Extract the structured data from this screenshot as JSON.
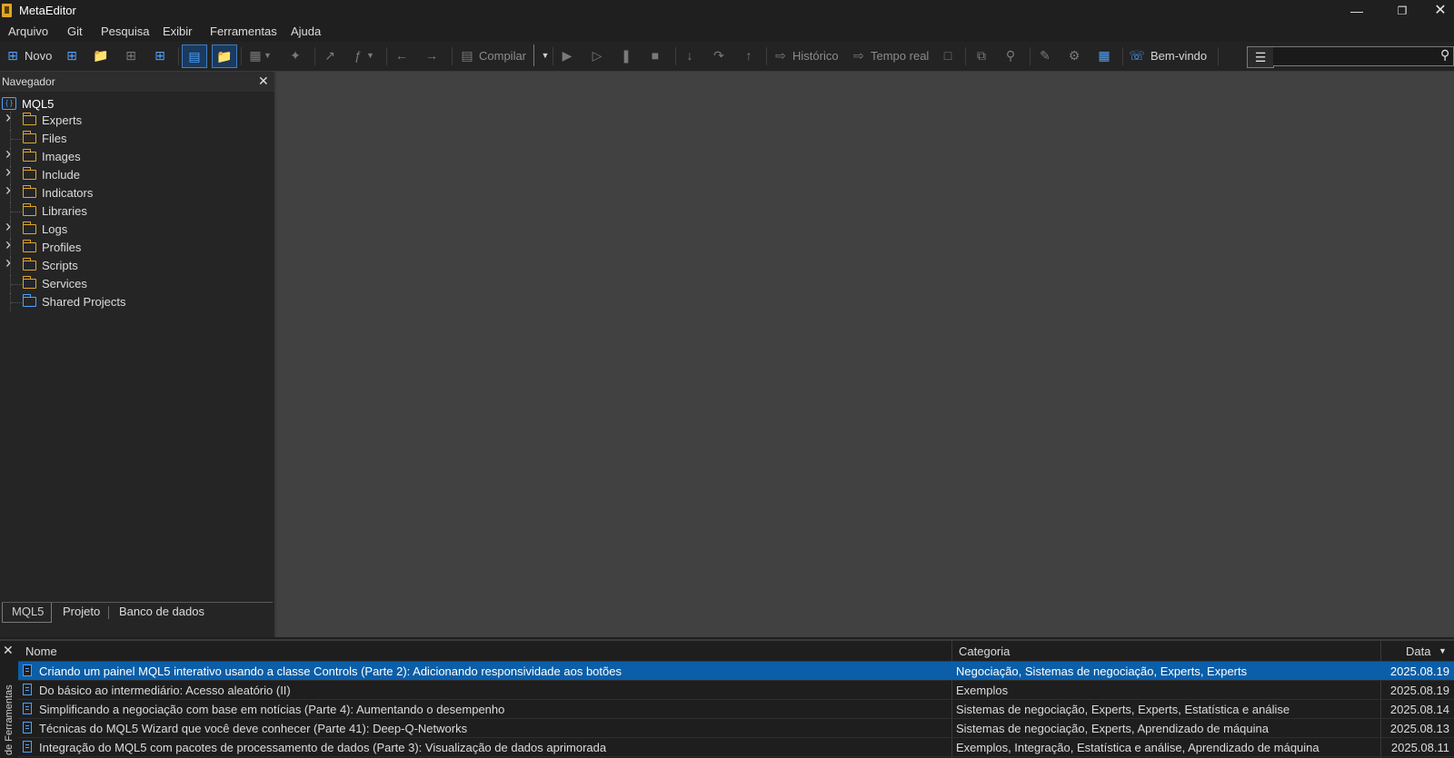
{
  "window": {
    "title": "MetaEditor"
  },
  "menu": [
    "Arquivo",
    "Git",
    "Pesquisa",
    "Exibir",
    "Ferramentas",
    "Ajuda"
  ],
  "toolbar": {
    "new_label": "Novo",
    "compile_label": "Compilar",
    "history_label": "Histórico",
    "realtime_label": "Tempo real",
    "welcome_label": "Bem-vindo",
    "search_placeholder": ""
  },
  "navigator": {
    "title": "Navegador",
    "root": "MQL5",
    "items": [
      {
        "label": "Experts",
        "expandable": true,
        "icon": "folder-icon"
      },
      {
        "label": "Files",
        "expandable": false,
        "icon": "folder-icon"
      },
      {
        "label": "Images",
        "expandable": true,
        "icon": "folder-icon"
      },
      {
        "label": "Include",
        "expandable": true,
        "icon": "folder-icon"
      },
      {
        "label": "Indicators",
        "expandable": true,
        "icon": "folder-icon"
      },
      {
        "label": "Libraries",
        "expandable": false,
        "icon": "folder-icon"
      },
      {
        "label": "Logs",
        "expandable": true,
        "icon": "folder-icon"
      },
      {
        "label": "Profiles",
        "expandable": true,
        "icon": "folder-icon"
      },
      {
        "label": "Scripts",
        "expandable": true,
        "icon": "folder-icon"
      },
      {
        "label": "Services",
        "expandable": false,
        "icon": "folder-icon"
      },
      {
        "label": "Shared Projects",
        "expandable": false,
        "icon": "shared-folder-icon"
      }
    ],
    "tabs": [
      "MQL5",
      "Projeto",
      "Banco de dados"
    ],
    "active_tab": "MQL5"
  },
  "toolbox": {
    "side_label": "de Ferramentas",
    "columns": {
      "name": "Nome",
      "category": "Categoria",
      "date": "Data"
    },
    "rows": [
      {
        "name": "Criando um painel MQL5 interativo usando a classe Controls (Parte 2): Adicionando responsividade aos botões",
        "category": "Negociação, Sistemas de negociação, Experts, Experts",
        "date": "2025.08.19",
        "selected": true
      },
      {
        "name": "Do básico ao intermediário: Acesso aleatório (II)",
        "category": "Exemplos",
        "date": "2025.08.19",
        "selected": false
      },
      {
        "name": "Simplificando a negociação com base em notícias (Parte 4): Aumentando o desempenho",
        "category": "Sistemas de negociação, Experts, Experts, Estatística e análise",
        "date": "2025.08.14",
        "selected": false
      },
      {
        "name": "Técnicas do MQL5 Wizard que você deve conhecer (Parte 41): Deep-Q-Networks",
        "category": "Sistemas de negociação, Experts, Aprendizado de máquina",
        "date": "2025.08.13",
        "selected": false
      },
      {
        "name": "Integração do MQL5 com pacotes de processamento de dados (Parte 3): Visualização de dados aprimorada",
        "category": "Exemplos, Integração, Estatística e análise, Aprendizado de máquina",
        "date": "2025.08.11",
        "selected": false
      }
    ]
  },
  "colors": {
    "accent": "#4ea3ff",
    "folder": "#e0a62a",
    "selection": "#0b5ea8",
    "editor_bg": "#414141"
  }
}
